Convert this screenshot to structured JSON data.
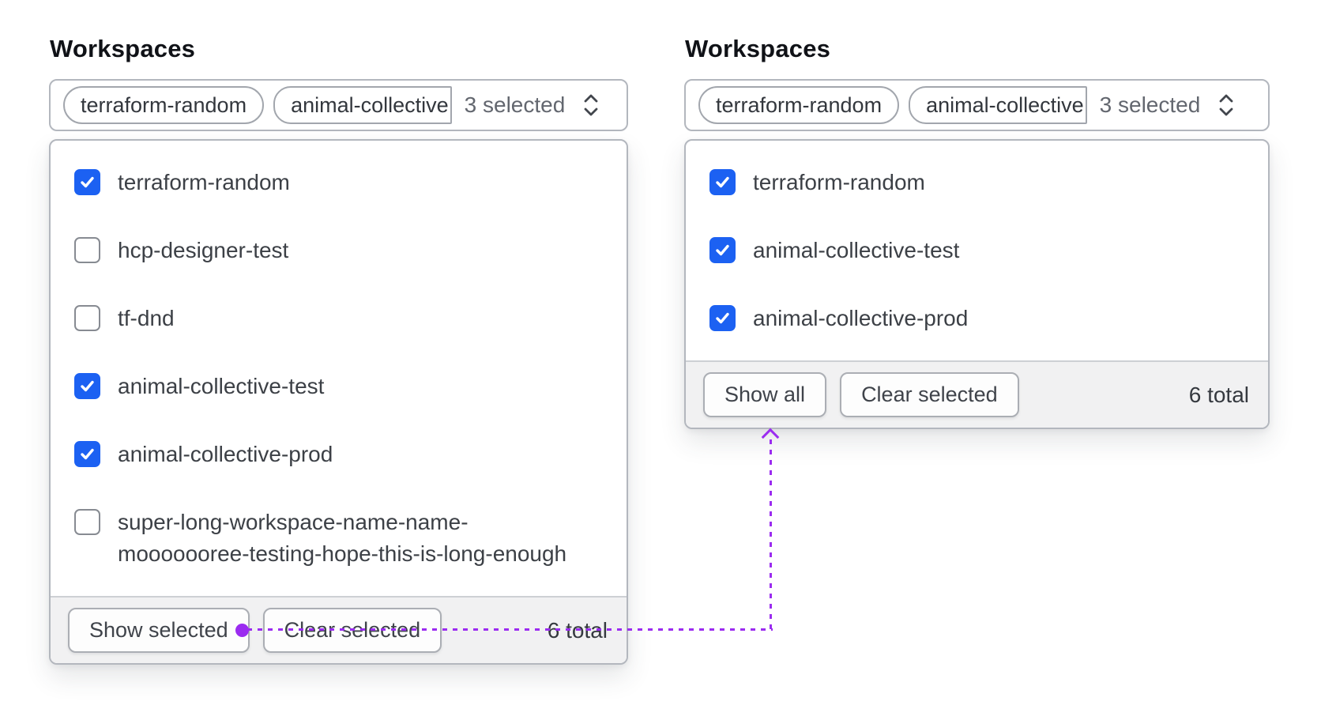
{
  "colors": {
    "accent_blue": "#1c61f2",
    "annotation_purple": "#9b2cf0"
  },
  "left_panel": {
    "title": "Workspaces",
    "trigger": {
      "pill_1": "terraform-random",
      "pill_2": "animal-collective",
      "count_label": "3 selected"
    },
    "options": [
      {
        "label": "terraform-random",
        "checked": true
      },
      {
        "label": "hcp-designer-test",
        "checked": false
      },
      {
        "label": "tf-dnd",
        "checked": false
      },
      {
        "label": "animal-collective-test",
        "checked": true
      },
      {
        "label": "animal-collective-prod",
        "checked": true
      },
      {
        "label": "super-long-workspace-name-name-mooooooree-testing-hope-this-is-long-enough",
        "checked": false
      }
    ],
    "footer": {
      "show_button": "Show selected",
      "clear_button": "Clear selected",
      "total": "6 total"
    }
  },
  "right_panel": {
    "title": "Workspaces",
    "trigger": {
      "pill_1": "terraform-random",
      "pill_2": "animal-collective",
      "count_label": "3 selected"
    },
    "options": [
      {
        "label": "terraform-random",
        "checked": true
      },
      {
        "label": "animal-collective-test",
        "checked": true
      },
      {
        "label": "animal-collective-prod",
        "checked": true
      }
    ],
    "footer": {
      "show_button": "Show all",
      "clear_button": "Clear selected",
      "total": "6 total"
    }
  }
}
